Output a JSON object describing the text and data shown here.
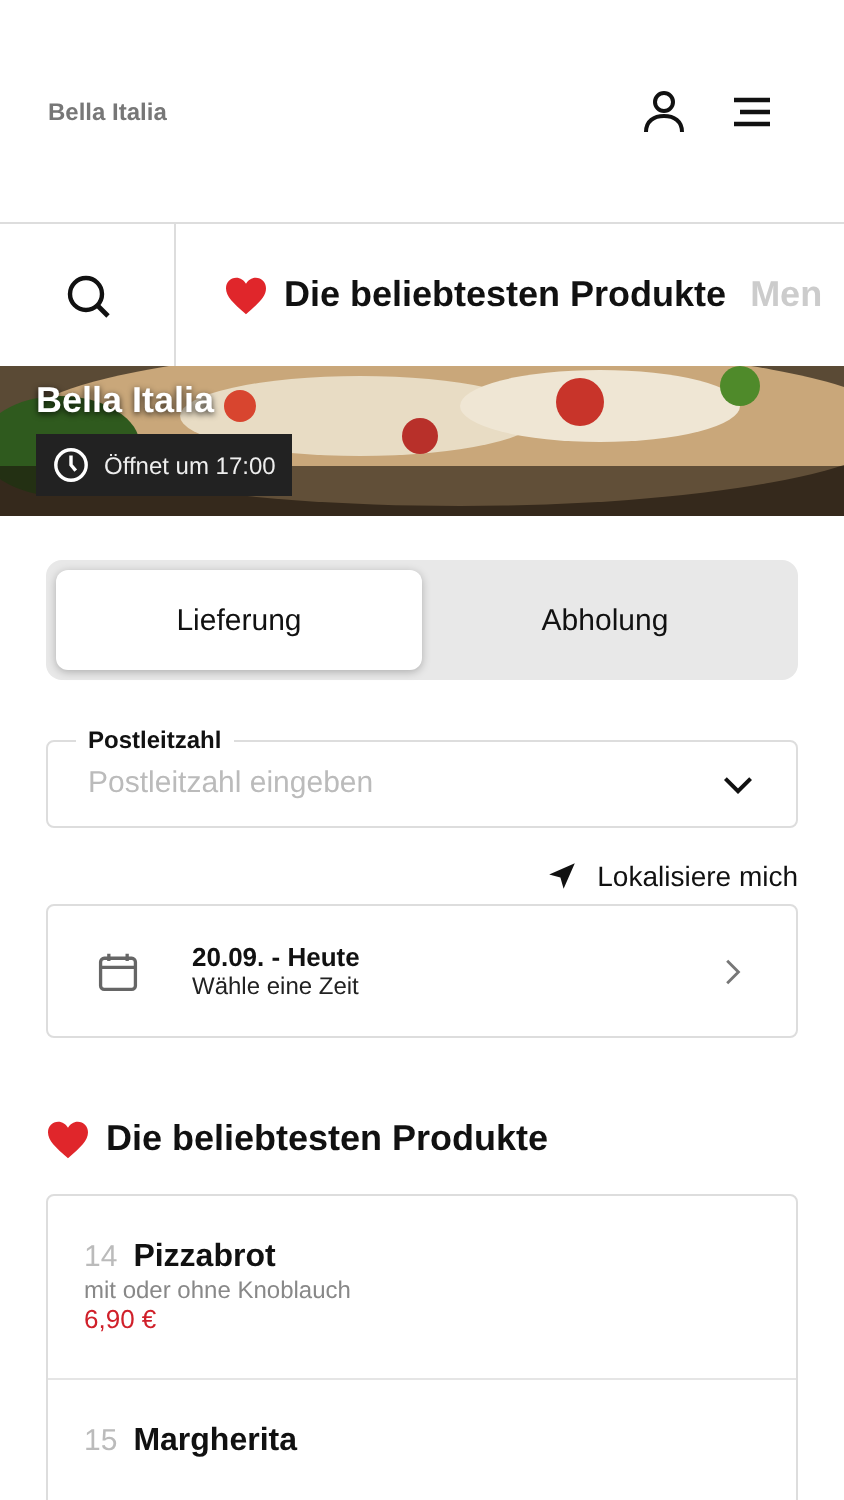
{
  "header": {
    "restaurant": "Bella Italia"
  },
  "category_tabs": [
    {
      "label": "Die beliebtesten Produkte",
      "selected": true,
      "kind": "favorite"
    },
    {
      "label": "Men",
      "selected": false,
      "kind": "plain"
    }
  ],
  "hero": {
    "title": "Bella Italia",
    "opening": "Öffnet um 17:00"
  },
  "order_mode": [
    {
      "label": "Lieferung",
      "selected": true
    },
    {
      "label": "Abholung",
      "selected": false
    }
  ],
  "postcode": {
    "label": "Postleitzahl",
    "placeholder": "Postleitzahl eingeben"
  },
  "locate": "Lokalisiere mich",
  "time": {
    "date": "20.09. - Heute",
    "hint": "Wähle eine Zeit"
  },
  "section_title": "Die beliebtesten Produkte",
  "products": [
    {
      "number": "14",
      "name": "Pizzabrot",
      "description": "mit oder ohne Knoblauch",
      "price": "6,90 €"
    },
    {
      "number": "15",
      "name": "Margherita"
    }
  ]
}
